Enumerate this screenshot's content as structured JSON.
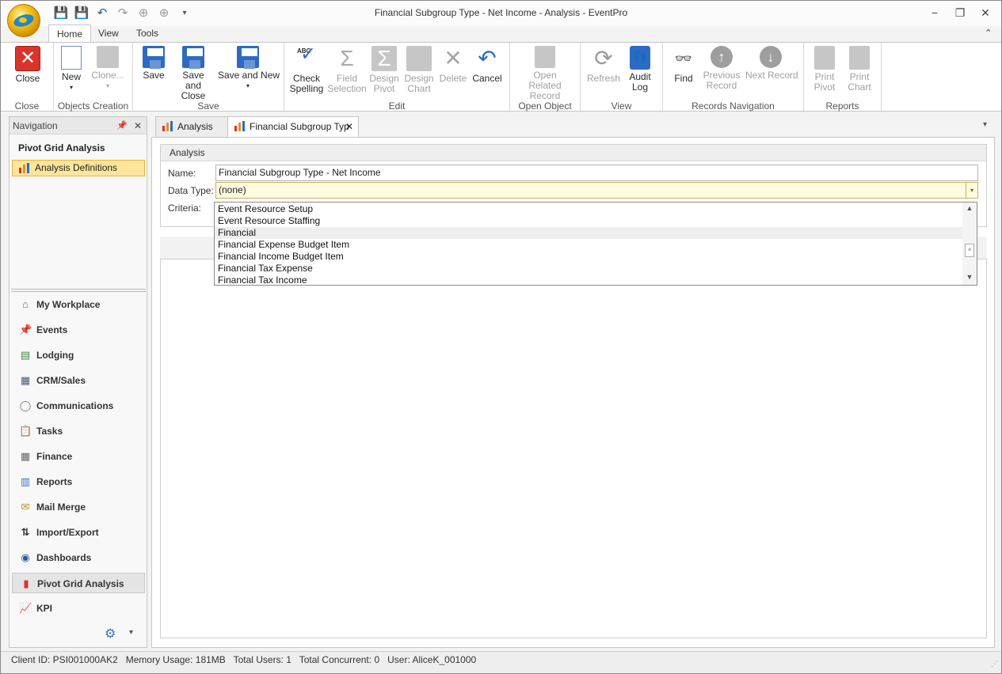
{
  "window": {
    "title": "Financial Subgroup Type - Net Income - Analysis - EventPro",
    "controls": {
      "minimize": "−",
      "restore": "❐",
      "close": "✕"
    }
  },
  "quick_access": [
    {
      "icon": "save-icon",
      "glyph": "💾"
    },
    {
      "icon": "save-close-icon",
      "glyph": "💾"
    },
    {
      "icon": "undo-icon",
      "glyph": "↶"
    },
    {
      "icon": "redo-icon",
      "glyph": "↷"
    },
    {
      "icon": "previous-icon",
      "glyph": "⊕"
    },
    {
      "icon": "next-icon",
      "glyph": "⊕"
    },
    {
      "icon": "customize-icon",
      "glyph": "▾"
    }
  ],
  "ribbon_tabs": [
    "Home",
    "View",
    "Tools"
  ],
  "ribbon_collapse_glyph": "⌃",
  "ribbon": {
    "close_group": {
      "caption": "Close",
      "close_label": "Close",
      "close_glyph": "✕"
    },
    "objects_group": {
      "caption": "Objects Creation",
      "new_label": "New",
      "clone_label": "Clone...",
      "dd": "▾"
    },
    "save_group": {
      "caption": "Save",
      "save_label": "Save",
      "save_close_label": "Save and Close",
      "save_new_label": "Save and New",
      "dd": "▾"
    },
    "edit_group": {
      "caption": "Edit",
      "check_spelling_label": "Check Spelling",
      "field_selection_label": "Field Selection",
      "design_pivot_label": "Design Pivot",
      "design_chart_label": "Design Chart",
      "delete_label": "Delete",
      "cancel_label": "Cancel",
      "abc": "ABC",
      "check_glyph": "✓",
      "sigma": "Σ",
      "delete_glyph": "✕",
      "cancel_glyph": "↶"
    },
    "open_object_group": {
      "caption": "Open Object",
      "open_related_label": "Open Related Record"
    },
    "view_group": {
      "caption": "View",
      "refresh_label": "Refresh",
      "audit_log_label": "Audit Log",
      "refresh_glyph": "⟳",
      "audit_glyph": "👣"
    },
    "records_nav_group": {
      "caption": "Records Navigation",
      "find_label": "Find",
      "previous_label": "Previous Record",
      "next_label": "Next Record",
      "find_glyph": "👓",
      "prev_glyph": "↑",
      "next_glyph": "↓"
    },
    "reports_group": {
      "caption": "Reports",
      "print_pivot_label": "Print Pivot",
      "print_chart_label": "Print Chart"
    }
  },
  "navigation": {
    "header": "Navigation",
    "pin_glyph": "📌",
    "close_glyph": "✕",
    "section_title": "Pivot Grid Analysis",
    "selected_item": "Analysis Definitions",
    "items": [
      {
        "label": "My Workplace",
        "icon": "home-icon",
        "glyph": "⌂"
      },
      {
        "label": "Events",
        "icon": "pushpin-icon",
        "glyph": "📌"
      },
      {
        "label": "Lodging",
        "icon": "lodging-icon",
        "glyph": "▤"
      },
      {
        "label": "CRM/Sales",
        "icon": "crm-icon",
        "glyph": "▦"
      },
      {
        "label": "Communications",
        "icon": "speech-bubble-icon",
        "glyph": "◯"
      },
      {
        "label": "Tasks",
        "icon": "clipboard-icon",
        "glyph": "📋"
      },
      {
        "label": "Finance",
        "icon": "calculator-icon",
        "glyph": "▦"
      },
      {
        "label": "Reports",
        "icon": "report-icon",
        "glyph": "▥"
      },
      {
        "label": "Mail Merge",
        "icon": "mail-merge-icon",
        "glyph": "✉"
      },
      {
        "label": "Import/Export",
        "icon": "import-export-icon",
        "glyph": "⇅"
      },
      {
        "label": "Dashboards",
        "icon": "dashboard-icon",
        "glyph": "◉"
      },
      {
        "label": "Pivot Grid Analysis",
        "icon": "pivot-chart-icon",
        "glyph": "▮"
      },
      {
        "label": "KPI",
        "icon": "kpi-chart-icon",
        "glyph": "📈"
      }
    ],
    "settings_glyph": "⚙",
    "settings_dd": "▾"
  },
  "doc_tabs": [
    {
      "label": "Analysis",
      "active": false
    },
    {
      "label": "Financial Subgroup Typ",
      "active": true
    }
  ],
  "doc_tab_close": "✕",
  "doc_tabs_dd": "▾",
  "analysis": {
    "header": "Analysis",
    "name_label": "Name:",
    "name_value": "Financial Subgroup Type - Net Income",
    "data_type_label": "Data Type:",
    "data_type_value": "(none)",
    "criteria_label": "Criteria:",
    "dd_glyph": "▾"
  },
  "dropdown": {
    "options": [
      "Event Resource Setup",
      "Event Resource Staffing",
      "Financial",
      "Financial Expense Budget Item",
      "Financial Income Budget Item",
      "Financial Tax Expense",
      "Financial Tax Income"
    ],
    "highlighted_index": 2,
    "scroll_up": "▲",
    "scroll_down": "▼",
    "thumb": "≡"
  },
  "status": {
    "text": "Client ID: PSI001000AK2   Memory Usage: 181MB   Total Users: 1   Total Concurrent: 0   User: AliceK_001000",
    "grip": "⋰"
  },
  "colors": {
    "accent_blue": "#2d6bc2",
    "nav_selected_bg": "#fde69c",
    "close_red": "#d9332b"
  }
}
